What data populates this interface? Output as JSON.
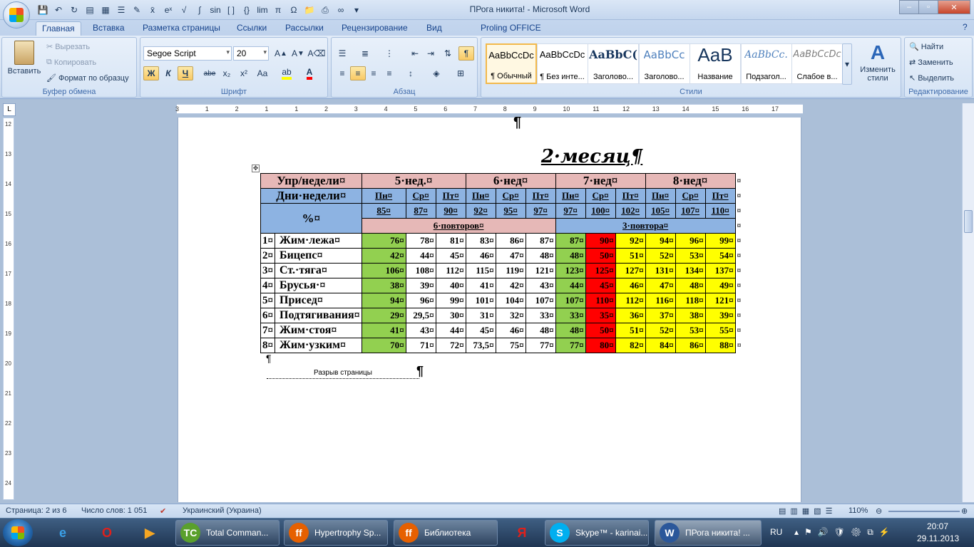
{
  "window": {
    "title": "ПРога никита! - Microsoft Word",
    "minimize": "–",
    "maximize": "▫",
    "close": "✕",
    "help": "?"
  },
  "tabs": [
    "Главная",
    "Вставка",
    "Разметка страницы",
    "Ссылки",
    "Рассылки",
    "Рецензирование",
    "Вид",
    "Proling OFFICE"
  ],
  "ribbon": {
    "clipboard": {
      "label": "Буфер обмена",
      "paste": "Вставить",
      "cut": "Вырезать",
      "copy": "Копировать",
      "format_painter": "Формат по образцу"
    },
    "font": {
      "label": "Шрифт",
      "family": "Segoe Script",
      "size": "20",
      "bold": "Ж",
      "italic": "К",
      "underline": "Ч",
      "strike": "abe",
      "sub": "x₂",
      "sup": "x²",
      "case": "Aa"
    },
    "paragraph": {
      "label": "Абзац"
    },
    "styles": {
      "label": "Стили",
      "items": [
        {
          "preview": "AaBbCcDc",
          "name": "¶ Обычный"
        },
        {
          "preview": "AaBbCcDc",
          "name": "¶ Без инте..."
        },
        {
          "preview": "AaBbC(",
          "name": "Заголово..."
        },
        {
          "preview": "AaBbCc",
          "name": "Заголово..."
        },
        {
          "preview": "AaB",
          "name": "Название"
        },
        {
          "preview": "AaBbCc.",
          "name": "Подзагол..."
        },
        {
          "preview": "AaBbCcDc",
          "name": "Слабое в..."
        }
      ],
      "change": "Изменить стили"
    },
    "editing": {
      "label": "Редактирование",
      "find": "Найти",
      "replace": "Заменить",
      "select": "Выделить"
    }
  },
  "ruler_marks": [
    "3",
    "1",
    "2",
    "1",
    "1",
    "2",
    "3",
    "4",
    "5",
    "6",
    "7",
    "8",
    "9",
    "10",
    "11",
    "12",
    "13",
    "14",
    "15",
    "16",
    "17"
  ],
  "vruler_marks": [
    "12",
    "13",
    "14",
    "15",
    "16",
    "17",
    "18",
    "19",
    "20",
    "21",
    "22",
    "23",
    "24"
  ],
  "document": {
    "top_pilcrow": "¶",
    "heading": "2·месяц¶",
    "table": {
      "head_row1": [
        "Упр/недели¤",
        "5·нед.¤",
        "6·нед¤",
        "7·нед¤",
        "8·нед¤"
      ],
      "head_row2_label": "Дни·недели¤",
      "days": [
        "Пн¤",
        "Ср¤",
        "Пт¤",
        "Пн¤",
        "Ср¤",
        "Пт¤",
        "Пн¤",
        "Ср¤",
        "Пт¤",
        "Пн¤",
        "Ср¤",
        "Пт¤"
      ],
      "pct_label": "%¤",
      "percents": [
        "85¤",
        "87¤",
        "90¤",
        "92¤",
        "95¤",
        "97¤",
        "97¤",
        "100¤",
        "102¤",
        "105¤",
        "107¤",
        "110¤"
      ],
      "reps_left": "6·повторов¤",
      "reps_right": "3·повтора¤",
      "row_end": "¤",
      "rows": [
        {
          "n": "1¤",
          "name": "Жим·лежа¤",
          "v": [
            "76¤",
            "78¤",
            "81¤",
            "83¤",
            "86¤",
            "87¤",
            "87¤",
            "90¤",
            "92¤",
            "94¤",
            "96¤",
            "99¤"
          ]
        },
        {
          "n": "2¤",
          "name": "Бицепс¤",
          "v": [
            "42¤",
            "44¤",
            "45¤",
            "46¤",
            "47¤",
            "48¤",
            "48¤",
            "50¤",
            "51¤",
            "52¤",
            "53¤",
            "54¤"
          ]
        },
        {
          "n": "3¤",
          "name": "Ст.·тяга¤",
          "v": [
            "106¤",
            "108¤",
            "112¤",
            "115¤",
            "119¤",
            "121¤",
            "123¤",
            "125¤",
            "127¤",
            "131¤",
            "134¤",
            "137¤"
          ]
        },
        {
          "n": "4¤",
          "name": "Брусья·¤",
          "v": [
            "38¤",
            "39¤",
            "40¤",
            "41¤",
            "42¤",
            "43¤",
            "44¤",
            "45¤",
            "46¤",
            "47¤",
            "48¤",
            "49¤"
          ]
        },
        {
          "n": "5¤",
          "name": "Присед¤",
          "v": [
            "94¤",
            "96¤",
            "99¤",
            "101¤",
            "104¤",
            "107¤",
            "107¤",
            "110¤",
            "112¤",
            "116¤",
            "118¤",
            "121¤"
          ]
        },
        {
          "n": "6¤",
          "name": "Подтягивания¤",
          "v": [
            "29¤",
            "29,5¤",
            "30¤",
            "31¤",
            "32¤",
            "33¤",
            "33¤",
            "35¤",
            "36¤",
            "37¤",
            "38¤",
            "39¤"
          ]
        },
        {
          "n": "7¤",
          "name": "Жим·стоя¤",
          "v": [
            "41¤",
            "43¤",
            "44¤",
            "45¤",
            "46¤",
            "48¤",
            "48¤",
            "50¤",
            "51¤",
            "52¤",
            "53¤",
            "55¤"
          ]
        },
        {
          "n": "8¤",
          "name": "Жим·узким¤",
          "v": [
            "70¤",
            "71¤",
            "72¤",
            "73,5¤",
            "75¤",
            "77¤",
            "77¤",
            "80¤",
            "82¤",
            "84¤",
            "86¤",
            "88¤"
          ]
        }
      ]
    },
    "after_pilcrow": "¶",
    "page_break": "Разрыв страницы",
    "page_break_pilcrow": "¶"
  },
  "status": {
    "page": "Страница: 2 из 6",
    "words": "Число слов: 1 051",
    "language": "Украинский (Украина)",
    "zoom": "110%"
  },
  "taskbar": {
    "tasks": [
      "Total Comman...",
      "Hypertrophy Sp...",
      "Библиотека",
      "Skype™ - karinai...",
      "ПРога никита! ..."
    ],
    "lang": "RU",
    "time": "20:07",
    "date": "29.11.2013"
  },
  "colors": {
    "green": "#92d050",
    "red": "#ff0000",
    "yellow": "#ffff00",
    "pink": "#e6b8b7",
    "blue": "#8db3e2"
  }
}
